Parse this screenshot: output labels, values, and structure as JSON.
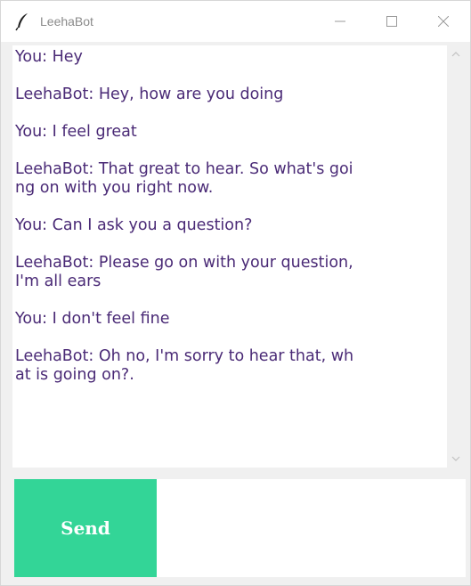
{
  "window": {
    "title": "LeehaBot",
    "controls": {
      "minimize": "–",
      "maximize": "☐",
      "close": "✕"
    }
  },
  "chat": {
    "messages": [
      "You: Hey",
      "LeehaBot: Hey, how are you doing",
      "You: I feel great",
      "LeehaBot: That great to hear. So what's goi\nng on with you right now.",
      "You: Can I ask you a question?",
      "LeehaBot: Please go on with your question,\nI'm all ears",
      "You: I don't feel fine",
      "LeehaBot: Oh no, I'm sorry to hear that, wh\nat is going on?."
    ]
  },
  "input": {
    "value": ""
  },
  "send_label": "Send",
  "colors": {
    "send_button": "#33d597",
    "chat_text": "#4a2a76",
    "background": "#f0f0f0"
  },
  "icons": {
    "app": "feather-icon",
    "scroll_up": "chevron-up-icon",
    "scroll_down": "chevron-down-icon"
  }
}
